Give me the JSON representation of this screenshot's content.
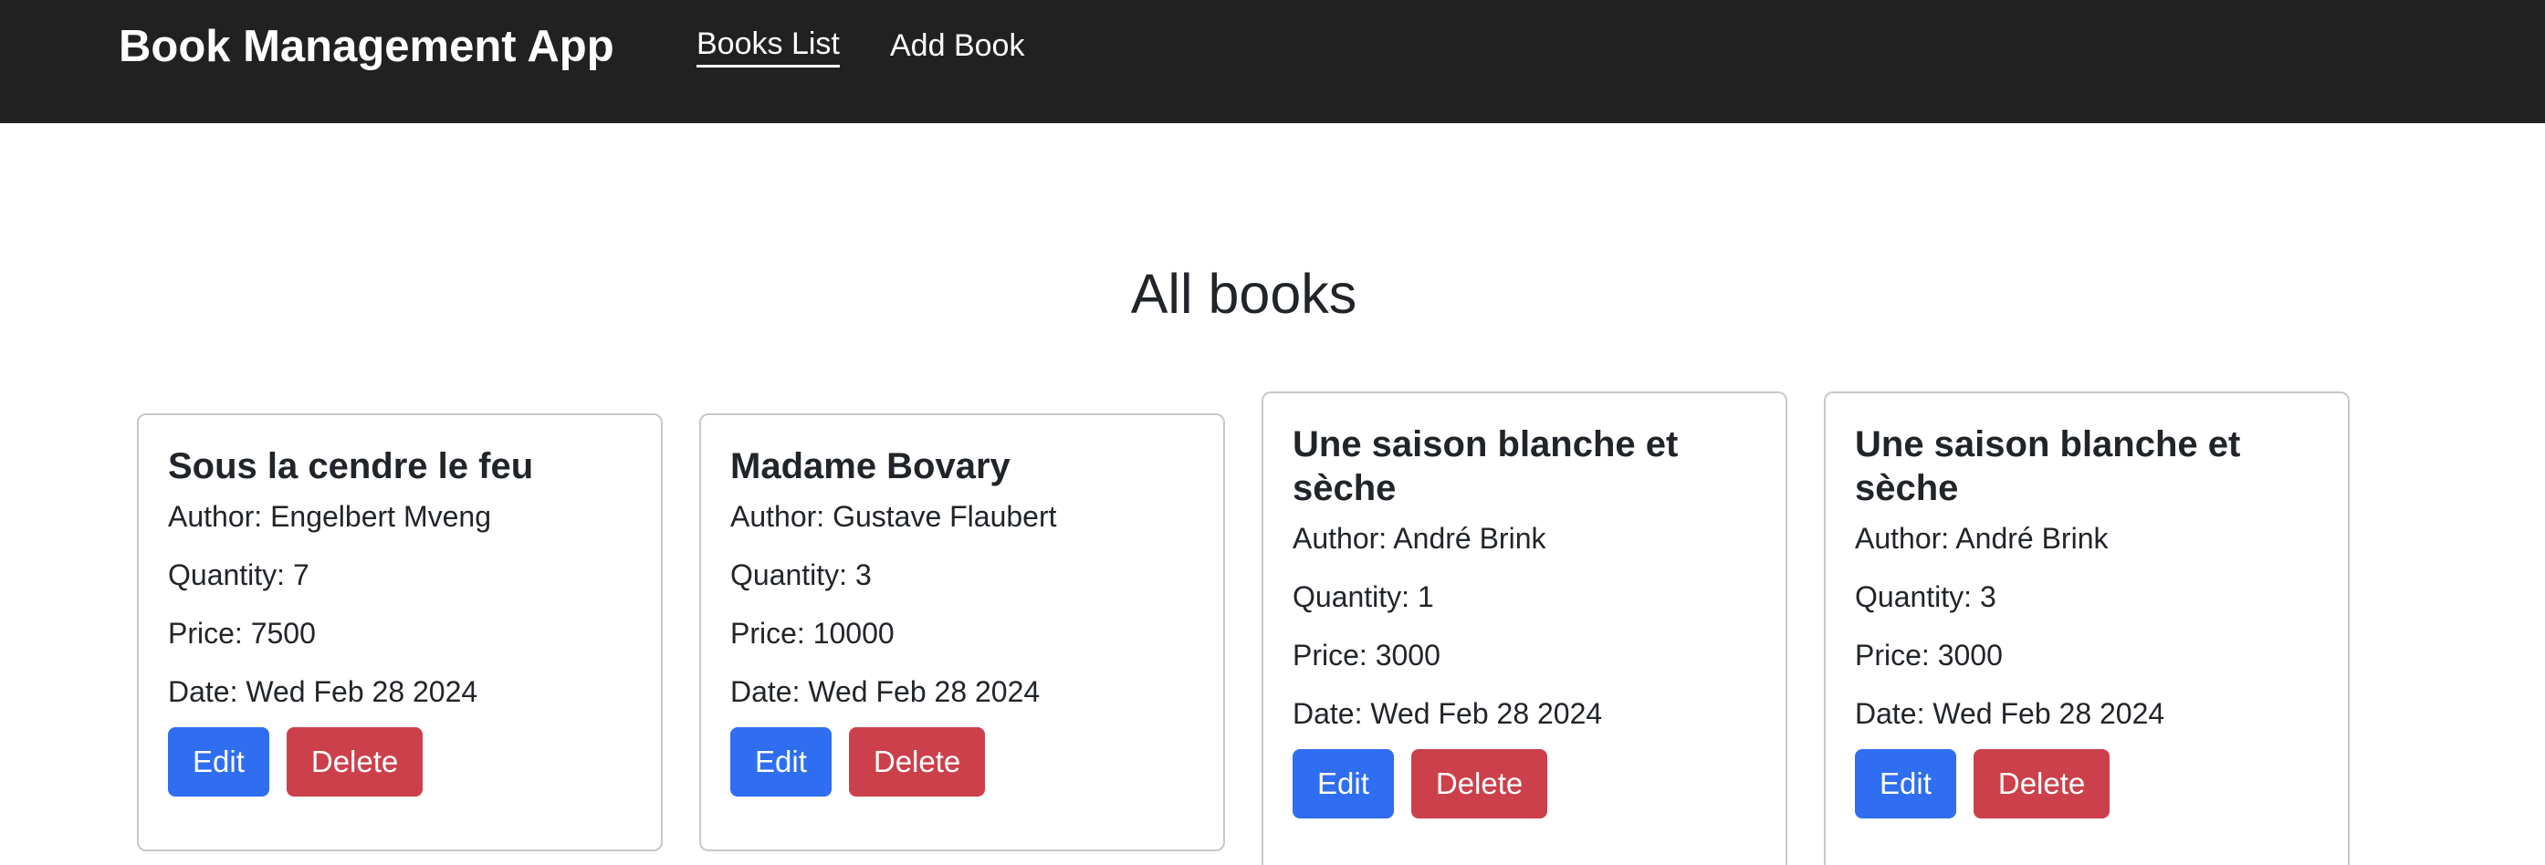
{
  "navbar": {
    "brand": "Book Management App",
    "links": [
      {
        "label": "Books List",
        "active": true
      },
      {
        "label": "Add Book",
        "active": false
      }
    ]
  },
  "main": {
    "heading": "All books"
  },
  "labels": {
    "author": "Author:",
    "quantity": "Quantity:",
    "price": "Price:",
    "date": "Date:",
    "edit": "Edit",
    "delete": "Delete"
  },
  "books": [
    {
      "title": "Sous la cendre le feu",
      "author": "Engelbert Mveng",
      "quantity": "7",
      "price": "7500",
      "date": "Wed Feb 28 2024"
    },
    {
      "title": "Madame Bovary",
      "author": "Gustave Flaubert",
      "quantity": "3",
      "price": "10000",
      "date": "Wed Feb 28 2024"
    },
    {
      "title": "Une saison blanche et sèche",
      "author": "André Brink",
      "quantity": "1",
      "price": "3000",
      "date": "Wed Feb 28 2024"
    },
    {
      "title": "Une saison blanche et sèche",
      "author": "André Brink",
      "quantity": "3",
      "price": "3000",
      "date": "Wed Feb 28 2024"
    }
  ],
  "colors": {
    "navbar_bg": "#212121",
    "edit_button": "#2f6ef0",
    "delete_button": "#cc404b"
  }
}
